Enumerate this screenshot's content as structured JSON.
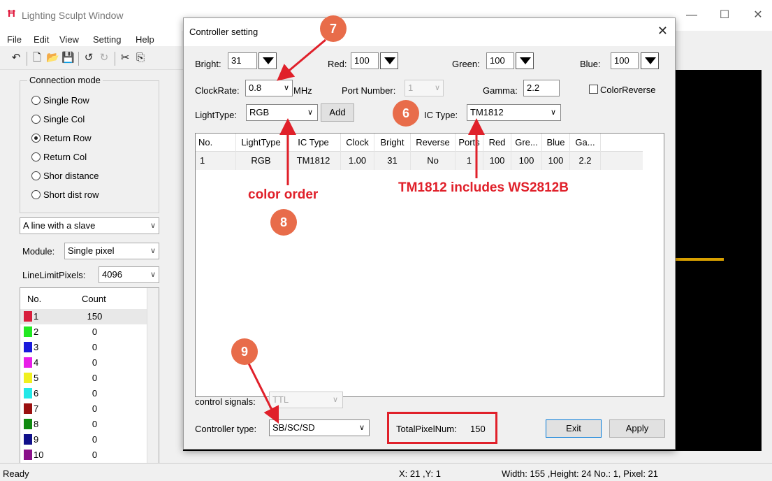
{
  "window": {
    "title": "Lighting Sculpt Window",
    "icon": "app-logo-icon"
  },
  "menu": [
    "File",
    "Edit",
    "View",
    "Setting",
    "Help"
  ],
  "connection_mode": {
    "legend": "Connection mode",
    "options": [
      "Single Row",
      "Single Col",
      "Return Row",
      "Return Col",
      "Shor distance",
      "Short dist row"
    ],
    "selected": "Return Row"
  },
  "left": {
    "line_mode": "A line with a slave",
    "module_label": "Module:",
    "module_value": "Single pixel",
    "limit_label": "LineLimitPixels:",
    "limit_value": "4096",
    "list_headers": [
      "No.",
      "Count"
    ],
    "list_rows": [
      {
        "no": "1",
        "count": "150",
        "color": "#d81e3c"
      },
      {
        "no": "2",
        "count": "0",
        "color": "#22e822"
      },
      {
        "no": "3",
        "count": "0",
        "color": "#1a1adc"
      },
      {
        "no": "4",
        "count": "0",
        "color": "#e81ee8"
      },
      {
        "no": "5",
        "count": "0",
        "color": "#f0f020"
      },
      {
        "no": "6",
        "count": "0",
        "color": "#22e8e8"
      },
      {
        "no": "7",
        "count": "0",
        "color": "#9a1010"
      },
      {
        "no": "8",
        "count": "0",
        "color": "#108a10"
      },
      {
        "no": "9",
        "count": "0",
        "color": "#10108a"
      },
      {
        "no": "10",
        "count": "0",
        "color": "#8a108a"
      }
    ]
  },
  "status": {
    "ready": "Ready",
    "coords": "X: 21 ,Y: 1",
    "info": "Width: 155 ,Height: 24  No.: 1, Pixel: 21"
  },
  "dialog": {
    "title": "Controller setting",
    "bright_label": "Bright:",
    "bright": "31",
    "red_label": "Red:",
    "red": "100",
    "green_label": "Green:",
    "green": "100",
    "blue_label": "Blue:",
    "blue": "100",
    "clockrate_label": "ClockRate:",
    "clockrate": "0.8",
    "clock_unit": "MHz",
    "port_label": "Port Number:",
    "port": "1",
    "gamma_label": "Gamma:",
    "gamma": "2.2",
    "color_reverse_label": "ColorReverse",
    "lighttype_label": "LightType:",
    "lighttype": "RGB",
    "add_label": "Add",
    "ictype_label": "IC Type:",
    "ictype": "TM1812",
    "grid_headers": [
      "No.",
      "LightType",
      "IC Type",
      "Clock",
      "Bright",
      "Reverse",
      "Ports",
      "Red",
      "Gre...",
      "Blue",
      "Ga..."
    ],
    "grid_rows": [
      [
        "1",
        "RGB",
        "TM1812",
        "1.00",
        "31",
        "No",
        "1",
        "100",
        "100",
        "100",
        "2.2"
      ]
    ],
    "control_signals_label": "control signals:",
    "control_signals": "TTL",
    "controller_type_label": "Controller type:",
    "controller_type": "SB/SC/SD",
    "total_label": "TotalPixelNum:",
    "total": "150",
    "exit_label": "Exit",
    "apply_label": "Apply"
  },
  "annotations": {
    "badges": [
      "7",
      "6",
      "8",
      "9"
    ],
    "color_order": "color order",
    "tm1812_note": "TM1812 includes WS2812B",
    "accent_color": "#e0202a",
    "badge_color": "#e86c4a"
  }
}
